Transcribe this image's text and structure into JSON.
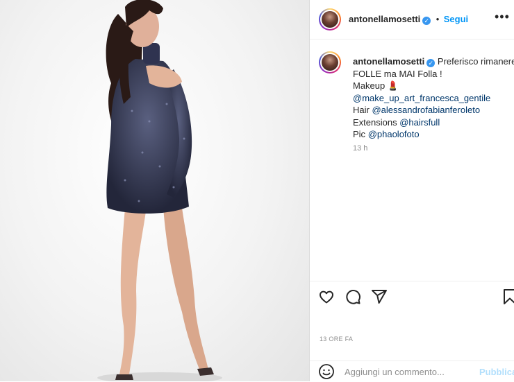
{
  "post": {
    "username": "antonellamosetti",
    "separator": "•",
    "follow_label": "Segui",
    "more_icon": "more-dots-icon",
    "caption": {
      "first": "Preferisco rimanere",
      "line2": "FOLLE ma MAI Folla !",
      "makeup_label": "Makeup 💄",
      "makeup_handle": "@make_up_art_francesca_gentile",
      "hair_label": "Hair",
      "hair_handle": "@alessandrofabianferoleto",
      "ext_label": "Extensions",
      "ext_handle": "@hairsfull",
      "pic_label": "Pic",
      "pic_handle": "@phaolofoto"
    },
    "caption_time": "13 h",
    "timestamp": "13 ORE FA",
    "comment_placeholder": "Aggiungi un commento...",
    "publish_label": "Pubblica"
  },
  "colors": {
    "accent": "#0095f6",
    "link": "#00376b",
    "muted": "#8e8e8e",
    "dress": "#2b2f4a"
  }
}
